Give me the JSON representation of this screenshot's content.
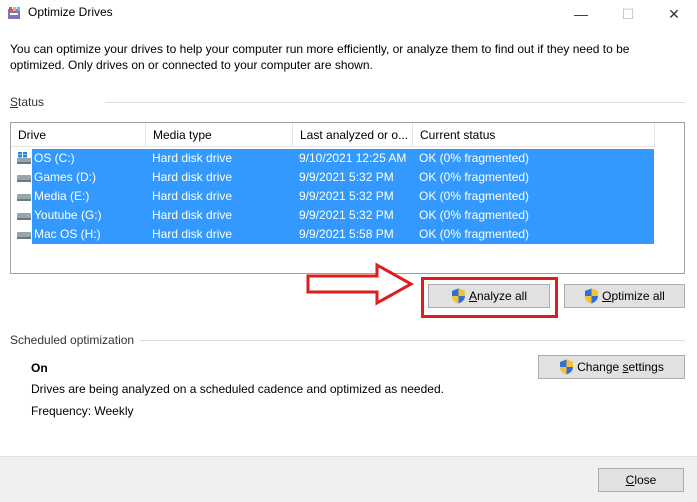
{
  "window": {
    "title": "Optimize Drives",
    "min_glyph": "—",
    "max_glyph": "☐",
    "close_glyph": "✕"
  },
  "intro_text": "You can optimize your drives to help your computer run more efficiently, or analyze them to find out if they need to be optimized. Only drives on or connected to your computer are shown.",
  "status": {
    "label_first": "S",
    "label_rest": "tatus",
    "columns": [
      "Drive",
      "Media type",
      "Last analyzed or o...",
      "Current status"
    ],
    "drives": [
      {
        "name": "OS (C:)",
        "media": "Hard disk drive",
        "last_analyzed": "9/10/2021 12:25 AM",
        "status": "OK (0% fragmented)",
        "icon": "windows-drive-icon"
      },
      {
        "name": "Games (D:)",
        "media": "Hard disk drive",
        "last_analyzed": "9/9/2021 5:32 PM",
        "status": "OK (0% fragmented)",
        "icon": "hard-drive-icon"
      },
      {
        "name": "Media (E:)",
        "media": "Hard disk drive",
        "last_analyzed": "9/9/2021 5:32 PM",
        "status": "OK (0% fragmented)",
        "icon": "hard-drive-icon"
      },
      {
        "name": "Youtube (G:)",
        "media": "Hard disk drive",
        "last_analyzed": "9/9/2021 5:32 PM",
        "status": "OK (0% fragmented)",
        "icon": "hard-drive-icon"
      },
      {
        "name": "Mac OS (H:)",
        "media": "Hard disk drive",
        "last_analyzed": "9/9/2021 5:58 PM",
        "status": "OK (0% fragmented)",
        "icon": "hard-drive-icon"
      }
    ]
  },
  "buttons": {
    "analyze_first": "A",
    "analyze_rest": "nalyze all",
    "optimize_first": "O",
    "optimize_rest": "ptimize all",
    "change_pre": "Change ",
    "change_first": "s",
    "change_rest": "ettings",
    "close_first": "C",
    "close_rest": "lose"
  },
  "scheduled": {
    "label": "Scheduled optimization",
    "state": "On",
    "description": "Drives are being analyzed on a scheduled cadence and optimized as needed.",
    "frequency": "Frequency: Weekly"
  },
  "colors": {
    "selection": "#3399ff",
    "highlight": "#e01c1c"
  }
}
